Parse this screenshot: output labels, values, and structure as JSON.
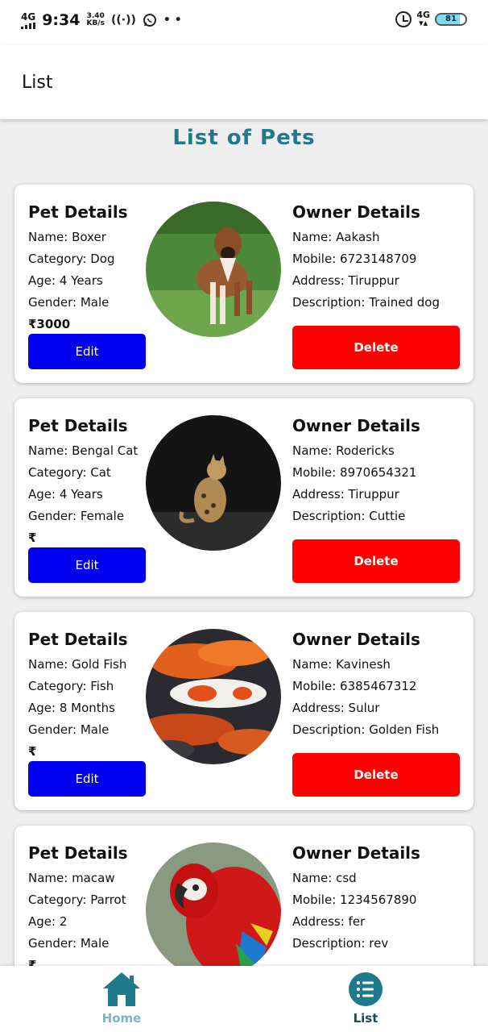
{
  "status_bar": {
    "network": "4G",
    "time": "9:34",
    "speed_value": "3.40",
    "speed_unit": "KB/s",
    "net_right": "4G",
    "battery": "81",
    "icons": [
      "signal-bars-icon",
      "hotspot-icon",
      "whatsapp-icon",
      "more-dots-icon",
      "alarm-icon",
      "battery-icon"
    ]
  },
  "app_bar": {
    "title": "List"
  },
  "page_title": "List of Pets",
  "labels": {
    "pet_details": "Pet Details",
    "owner_details": "Owner Details",
    "edit": "Edit",
    "delete": "Delete"
  },
  "pets": [
    {
      "name": "Name: Boxer",
      "category": "Category: Dog",
      "age": "Age: 4 Years",
      "gender": "Gender: Male",
      "price": "₹3000",
      "owner_name": "Name: Aakash",
      "mobile": "Mobile: 6723148709",
      "address": "Address: Tiruppur",
      "description": "Description: Trained dog"
    },
    {
      "name": "Name: Bengal Cat",
      "category": "Category: Cat",
      "age": "Age: 4 Years",
      "gender": "Gender: Female",
      "price": "₹",
      "owner_name": "Name: Rodericks",
      "mobile": "Mobile: 8970654321",
      "address": "Address: Tiruppur",
      "description": "Description: Cuttie"
    },
    {
      "name": "Name: Gold Fish",
      "category": "Category: Fish",
      "age": "Age: 8 Months",
      "gender": "Gender: Male",
      "price": "₹",
      "owner_name": "Name: Kavinesh",
      "mobile": "Mobile: 6385467312",
      "address": "Address: Sulur",
      "description": "Description: Golden Fish"
    },
    {
      "name": "Name: macaw",
      "category": "Category: Parrot",
      "age": "Age: 2",
      "gender": "Gender: Male",
      "price": "₹",
      "owner_name": "Name: csd",
      "mobile": "Mobile: 1234567890",
      "address": "Address: fer",
      "description": "Description: rev"
    }
  ],
  "bottom_nav": {
    "home_label": "Home",
    "list_label": "List"
  },
  "colors": {
    "accent": "#1f7b8c",
    "edit_button": "#0000ee",
    "delete_button": "#ff0000"
  }
}
